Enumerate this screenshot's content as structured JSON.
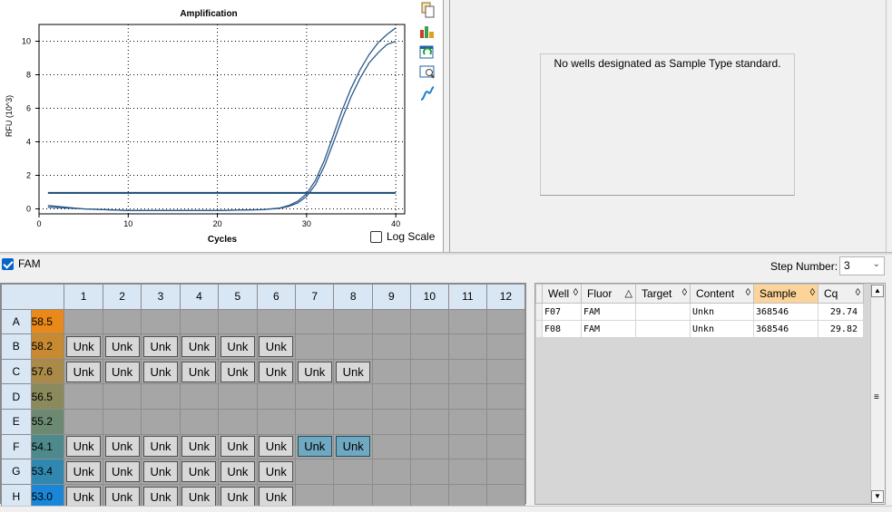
{
  "chart": {
    "title": "Amplification",
    "xlabel": "Cycles",
    "ylabel": "RFU (10^3)",
    "x_ticks": [
      "0",
      "10",
      "20",
      "30",
      "40"
    ],
    "y_ticks": [
      "0",
      "2",
      "4",
      "6",
      "8",
      "10"
    ],
    "log_scale_label": "Log Scale"
  },
  "chart_data": {
    "type": "line",
    "title": "Amplification",
    "xlabel": "Cycles",
    "ylabel": "RFU (10^3)",
    "xlim": [
      0,
      41
    ],
    "ylim": [
      -0.3,
      11
    ],
    "grid": true,
    "series": [
      {
        "x": [
          1,
          5,
          10,
          15,
          20,
          25,
          27,
          28,
          29,
          30,
          31,
          32,
          33,
          34,
          35,
          36,
          37,
          38,
          39,
          40
        ],
        "values": [
          0.2,
          0.0,
          -0.1,
          -0.1,
          -0.1,
          -0.05,
          0.05,
          0.2,
          0.45,
          0.9,
          1.7,
          2.9,
          4.4,
          5.9,
          7.2,
          8.3,
          9.2,
          9.9,
          10.4,
          10.8
        ]
      },
      {
        "x": [
          1,
          5,
          10,
          15,
          20,
          25,
          27,
          28,
          29,
          30,
          31,
          32,
          33,
          34,
          35,
          36,
          37,
          38,
          39,
          40
        ],
        "values": [
          0.1,
          0.0,
          -0.1,
          -0.1,
          -0.1,
          -0.05,
          0.03,
          0.15,
          0.35,
          0.75,
          1.45,
          2.55,
          3.95,
          5.4,
          6.7,
          7.8,
          8.7,
          9.3,
          9.8,
          10.0
        ]
      }
    ],
    "threshold": 0.95
  },
  "toolbar_icons": [
    "copy-icon",
    "export-chart-icon",
    "refresh-icon",
    "zoom-chart-icon",
    "curve-icon"
  ],
  "standard_curve": {
    "message": "No wells designated as Sample Type standard."
  },
  "fluor_filter": {
    "label": "FAM",
    "checked": true
  },
  "step": {
    "label": "Step Number:",
    "value": "3"
  },
  "plate": {
    "columns": [
      "1",
      "2",
      "3",
      "4",
      "5",
      "6",
      "7",
      "8",
      "9",
      "10",
      "11",
      "12"
    ],
    "rows": [
      {
        "label": "A",
        "temp": "58.5",
        "color": "#e8891a",
        "wells": [
          "",
          "",
          "",
          "",
          "",
          "",
          "",
          "",
          "",
          "",
          "",
          ""
        ]
      },
      {
        "label": "B",
        "temp": "58.2",
        "color": "#c88a30",
        "wells": [
          "Unk",
          "Unk",
          "Unk",
          "Unk",
          "Unk",
          "Unk",
          "",
          "",
          "",
          "",
          "",
          ""
        ]
      },
      {
        "label": "C",
        "temp": "57.6",
        "color": "#a98a48",
        "wells": [
          "Unk",
          "Unk",
          "Unk",
          "Unk",
          "Unk",
          "Unk",
          "Unk",
          "Unk",
          "",
          "",
          "",
          ""
        ]
      },
      {
        "label": "D",
        "temp": "56.5",
        "color": "#8a8a5c",
        "wells": [
          "",
          "",
          "",
          "",
          "",
          "",
          "",
          "",
          "",
          "",
          "",
          ""
        ]
      },
      {
        "label": "E",
        "temp": "55.2",
        "color": "#6c8a72",
        "wells": [
          "",
          "",
          "",
          "",
          "",
          "",
          "",
          "",
          "",
          "",
          "",
          ""
        ]
      },
      {
        "label": "F",
        "temp": "54.1",
        "color": "#4e8a8c",
        "wells": [
          "Unk",
          "Unk",
          "Unk",
          "Unk",
          "Unk",
          "Unk",
          "Unk",
          "Unk",
          "",
          "",
          "",
          ""
        ],
        "selected": [
          6,
          7
        ]
      },
      {
        "label": "G",
        "temp": "53.4",
        "color": "#3088b0",
        "wells": [
          "Unk",
          "Unk",
          "Unk",
          "Unk",
          "Unk",
          "Unk",
          "",
          "",
          "",
          "",
          "",
          ""
        ]
      },
      {
        "label": "H",
        "temp": "53.0",
        "color": "#1a86d8",
        "wells": [
          "Unk",
          "Unk",
          "Unk",
          "Unk",
          "Unk",
          "Unk",
          "",
          "",
          "",
          "",
          "",
          ""
        ]
      }
    ]
  },
  "results": {
    "headers": [
      "Well",
      "Fluor",
      "Target",
      "Content",
      "Sample",
      "Cq"
    ],
    "rows": [
      [
        "F07",
        "FAM",
        "",
        "Unkn",
        "368546",
        "29.74"
      ],
      [
        "F08",
        "FAM",
        "",
        "Unkn",
        "368546",
        "29.82"
      ]
    ]
  }
}
